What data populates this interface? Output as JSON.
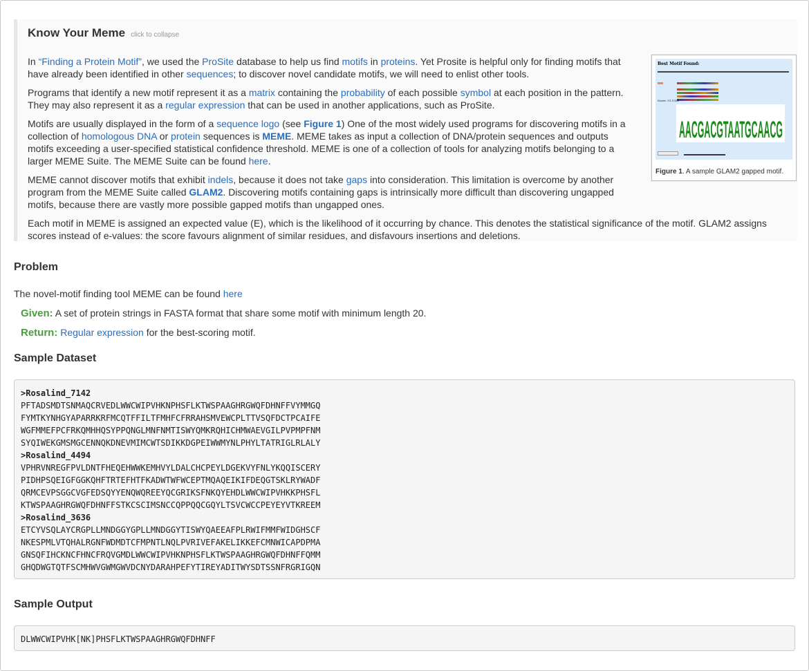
{
  "kym": {
    "title": "Know Your Meme",
    "collapse": "click to collapse",
    "p1": {
      "t1": "In ",
      "link_finding": "“Finding a Protein Motif”",
      "t2": ", we used the ",
      "link_prosite": "ProSite",
      "t3": " database to help us find ",
      "link_motifs": "motifs",
      "t4": " in ",
      "link_proteins": "proteins",
      "t5": ". Yet Prosite is helpful only for finding motifs that have already been identified in other ",
      "link_sequences": "sequences",
      "t6": "; to discover novel candidate motifs, we will need to enlist other tools."
    },
    "p2": {
      "t1": "Programs that identify a new motif represent it as a ",
      "link_matrix": "matrix",
      "t2": " containing the ",
      "link_probability": "probability",
      "t3": " of each possible ",
      "link_symbol": "symbol",
      "t4": " at each position in the pattern. They may also represent it as a ",
      "link_regex": "regular expression",
      "t5": " that can be used in another applications, such as ProSite."
    },
    "p3": {
      "t1": "Motifs are usually displayed in the form of a ",
      "link_logo": "sequence logo",
      "t2": " (see ",
      "link_fig": "Figure 1",
      "t3": ") One of the most widely used programs for discovering motifs in a collection of ",
      "link_homologous": "homologous",
      "t3b": " ",
      "link_dna": "DNA",
      "t4": " or ",
      "link_protein": "protein",
      "t5": " sequences is ",
      "link_meme": "MEME",
      "t6": ". MEME takes as input a collection of DNA/protein sequences and outputs motifs exceeding a user-specified statistical confidence threshold. MEME is one of a collection of tools for analyzing motifs belonging to a larger MEME Suite. The MEME Suite can be found ",
      "link_here": "here",
      "t7": "."
    },
    "p4": {
      "t1": "MEME cannot discover motifs that exhibit ",
      "link_indels": "indels",
      "t2": ", because it does not take ",
      "link_gaps": "gaps",
      "t3": " into consideration. This limitation is overcome by another program from the MEME Suite called ",
      "link_glam2": "GLAM2",
      "t4": ". Discovering motifs containing gaps is intrinsically more difficult than discovering ungapped motifs, because there are vastly more possible gapped motifs than ungapped ones."
    },
    "p5": "Each motif in MEME is assigned an expected value (E), which is the likelihood of it occurring by chance. This denotes the statistical significance of the motif. GLAM2 assigns scores instead of e-values: the score favours alignment of similar residues, and disfavours insertions and deletions.",
    "figure": {
      "heading": "Best Motif Found:",
      "caption_bold": "Figure 1",
      "caption_rest": ". A sample GLAM2 gapped motif.",
      "logo_letters": "AACGACGTAATGCAACG",
      "score": "Score: 51.1928"
    }
  },
  "problem": {
    "heading": "Problem",
    "text": "The novel-motif finding tool MEME can be found ",
    "link_here": "here",
    "given_label": "Given:",
    "given_text": " A set of protein strings in FASTA format that share some motif with minimum length 20.",
    "return_label": "Return:",
    "return_link": "Regular expression",
    "return_text": " for the best-scoring motif."
  },
  "dataset": {
    "heading": "Sample Dataset",
    "lines": [
      ">Rosalind_7142",
      "PFTADSMDTSNMAQCRVEDLWWCWIPVHKNPHSFLKTWSPAAGHRGWQFDHNFFVYMMGQ",
      "FYMTKYNHGYAPARRKRFMCQTFFILTFMHFCFRRAHSMVEWCPLTTVSQFDCTPCAIFE",
      "WGFMMEFPCFRKQMHHQSYPPQNGLMNFNMTISWYQMKRQHICHMWAEVGILPVPMPFNM",
      "SYQIWEKGMSMGCENNQKDNEVMIMCWTSDIKKDGPEIWWMYNLPHYLTATRIGLRLALY",
      ">Rosalind_4494",
      "VPHRVNREGFPVLDNTFHEQEHWWKEMHVYLDALCHCPEYLDGEKVYFNLYKQQISCERY",
      "PIDHPSQEIGFGGKQHFTRTEFHTFKADWTWFWCEPTMQAQEIKIFDEQGTSKLRYWADF",
      "QRMCEVPSGGCVGFEDSQYYENQWQREEYQCGRIKSFNKQYEHDLWWCWIPVHKKPHSFL",
      "KTWSPAAGHRGWQFDHNFFSTKCSCIMSNCCQPPQQCGQYLTSVCWCCPEYEYVTKREEM",
      ">Rosalind_3636",
      "ETCYVSQLAYCRGPLLMNDGGYGPLLMNDGGYTISWYQAEEAFPLRWIFMMFWIDGHSCF",
      "NKESPMLVTQHALRGNFWDMDTCFMPNTLNQLPVRIVEFAKELIKKEFCMNWICAPDPMA",
      "GNSQFIHCKNCFHNCFRQVGMDLWWCWIPVHKNPHSFLKTWSPAAGHRGWQFDHNFFQMM",
      "GHQDWGTQTFSCMHWVGWMGWVDCNYDARAHPEFYTIREYADITWYSDTSSNFRGRIGQN"
    ]
  },
  "output": {
    "heading": "Sample Output",
    "value": "DLWWCWIPVHK[NK]PHSFLKTWSPAAGHRGWQFDHNFF"
  }
}
